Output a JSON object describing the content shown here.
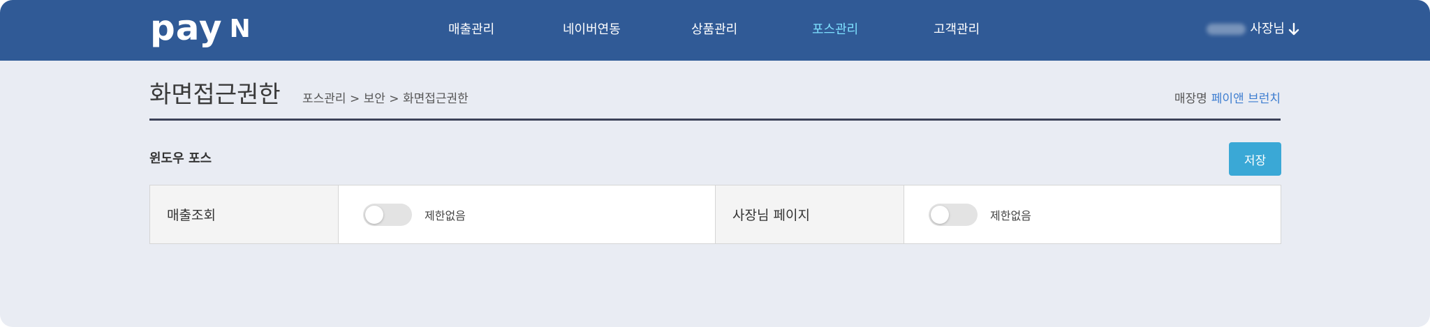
{
  "header": {
    "logo_text": "pay",
    "logo_mark": "N",
    "nav": [
      {
        "label": "매출관리",
        "active": false
      },
      {
        "label": "네이버연동",
        "active": false
      },
      {
        "label": "상품관리",
        "active": false
      },
      {
        "label": "포스관리",
        "active": true
      },
      {
        "label": "고객관리",
        "active": false
      }
    ],
    "user_label": "사장님",
    "user_icon": "arrow-down-icon",
    "bg_color": "#305a96",
    "active_color": "#7de0ff"
  },
  "page": {
    "title": "화면접근권한",
    "breadcrumb": "포스관리 > 보안 > 화면접근권한",
    "store_label": "매장명",
    "store_name": "페이앤 브런치"
  },
  "section": {
    "title": "윈도우 포스",
    "save_label": "저장",
    "save_color": "#3aa8d6"
  },
  "permissions": [
    {
      "label": "매출조회",
      "toggle_on": false,
      "status": "제한없음"
    },
    {
      "label": "사장님 페이지",
      "toggle_on": false,
      "status": "제한없음"
    }
  ]
}
